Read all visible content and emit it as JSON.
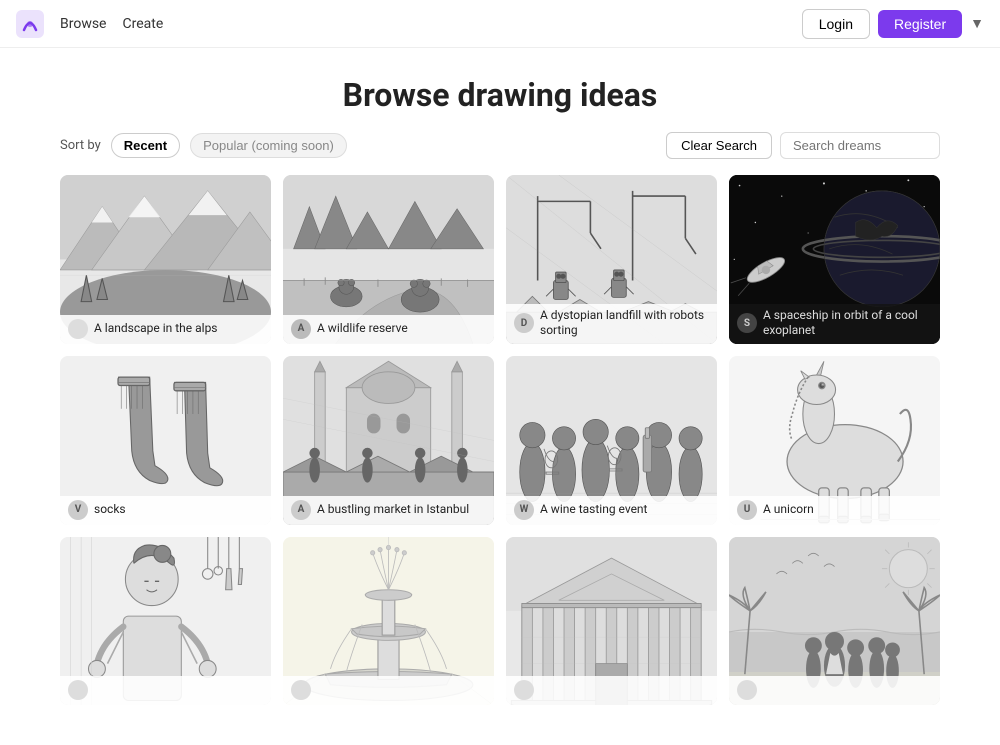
{
  "nav": {
    "browse_label": "Browse",
    "create_label": "Create",
    "login_label": "Login",
    "register_label": "Register"
  },
  "page": {
    "title": "Browse drawing ideas"
  },
  "sort_bar": {
    "label": "Sort by",
    "recent_label": "Recent",
    "popular_label": "Popular (coming soon)",
    "clear_search_label": "Clear Search",
    "search_placeholder": "Search dreams"
  },
  "drawings": [
    {
      "id": 1,
      "caption": "A landscape in the alps",
      "avatar": "",
      "style": "mountain"
    },
    {
      "id": 2,
      "caption": "A wildlife reserve",
      "avatar": "A",
      "style": "wildlife"
    },
    {
      "id": 3,
      "caption": "A dystopian landfill with robots sorting",
      "avatar": "D",
      "style": "dystopian"
    },
    {
      "id": 4,
      "caption": "A spaceship in orbit of a cool exoplanet",
      "avatar": "S",
      "style": "space"
    },
    {
      "id": 5,
      "caption": "socks",
      "avatar": "V",
      "style": "socks"
    },
    {
      "id": 6,
      "caption": "A bustling market in Istanbul",
      "avatar": "A",
      "style": "market"
    },
    {
      "id": 7,
      "caption": "A wine tasting event",
      "avatar": "W",
      "style": "wine"
    },
    {
      "id": 8,
      "caption": "A unicorn",
      "avatar": "U",
      "style": "unicorn"
    },
    {
      "id": 9,
      "caption": "",
      "avatar": "",
      "style": "chef"
    },
    {
      "id": 10,
      "caption": "",
      "avatar": "",
      "style": "fountain"
    },
    {
      "id": 11,
      "caption": "",
      "avatar": "",
      "style": "building"
    },
    {
      "id": 12,
      "caption": "",
      "avatar": "",
      "style": "beach"
    }
  ]
}
